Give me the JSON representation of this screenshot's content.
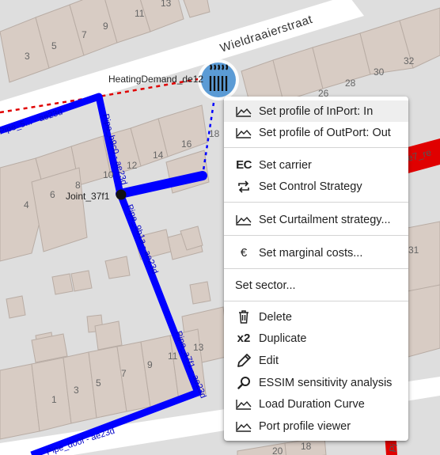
{
  "map": {
    "street_name": "Wieldraaierstraat",
    "heating_label": "HeatingDemand_de12",
    "joint_label": "Joint_37f1",
    "house_numbers": {
      "n13": "13",
      "n11": "11",
      "n9": "9",
      "n7": "7",
      "n5": "5",
      "n3": "3",
      "n32": "32",
      "n30": "30",
      "n28": "28",
      "n26": "26",
      "n18": "18",
      "n16": "16",
      "n14": "14",
      "n12": "12",
      "n10": "10",
      "n8": "8",
      "n6": "6",
      "n4": "4",
      "n31": "31",
      "s13": "13",
      "s11": "11",
      "s9": "9",
      "s7": "7",
      "s5": "5",
      "s3": "3",
      "s1": "1",
      "s20": "20",
      "s18": "18"
    },
    "pipe_labels": {
      "a": "Pipe_5... - ae23d",
      "b": "Pipe_b9c0 - ae23d",
      "c": "Pipe_9b1a - ae23d",
      "d": "Pipe_a7f1 - ae23d",
      "e": "Pipe_d00f - ae23d"
    },
    "red_label": "e7_re",
    "red_label2": "Pi"
  },
  "menu": {
    "items": [
      {
        "label": "Set profile of InPort: In",
        "icon": "chart-profile-icon"
      },
      {
        "label": "Set profile of OutPort: Out",
        "icon": "chart-profile-icon"
      },
      {
        "label": "Set carrier",
        "icon": "EC"
      },
      {
        "label": "Set Control Strategy",
        "icon": "repeat-icon"
      },
      {
        "label": "Set Curtailment strategy...",
        "icon": "chart-profile-icon"
      },
      {
        "label": "Set marginal costs...",
        "icon": "€"
      },
      {
        "label": "Set sector...",
        "icon": ""
      },
      {
        "label": "Delete",
        "icon": "trash-icon"
      },
      {
        "label": "Duplicate",
        "icon": "x2"
      },
      {
        "label": "Edit",
        "icon": "pencil-icon"
      },
      {
        "label": "ESSIM sensitivity analysis",
        "icon": "search-icon"
      },
      {
        "label": "Load Duration Curve",
        "icon": "chart-profile-icon"
      },
      {
        "label": "Port profile viewer",
        "icon": "chart-profile-icon"
      }
    ]
  },
  "colors": {
    "pipe": "#0000ff",
    "accent_red": "#e00000",
    "building_fill": "#d8ccc4",
    "heating_icon_bg": "#5b9bd5"
  }
}
